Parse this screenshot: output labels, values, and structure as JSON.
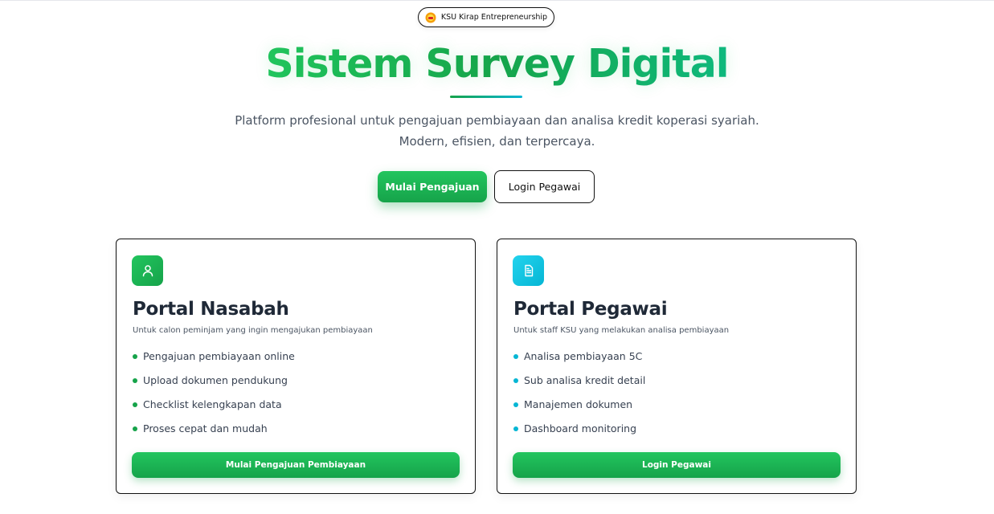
{
  "badge": {
    "label": "KSU Kirap Entrepreneurship",
    "icon": "ksu-logo-icon"
  },
  "hero": {
    "title": "Sistem Survey Digital",
    "subtitle_line1": "Platform profesional untuk pengajuan pembiayaan dan analisa kredit koperasi syariah.",
    "subtitle_line2": "Modern, efisien, dan terpercaya.",
    "primary_button": "Mulai Pengajuan",
    "secondary_button": "Login Pegawai"
  },
  "cards": [
    {
      "icon": "user-icon",
      "title": "Portal Nasabah",
      "description": "Untuk calon peminjam yang ingin mengajukan pembiayaan",
      "features": [
        "Pengajuan pembiayaan online",
        "Upload dokumen pendukung",
        "Checklist kelengkapan data",
        "Proses cepat dan mudah"
      ],
      "button": "Mulai Pengajuan Pembiayaan"
    },
    {
      "icon": "document-icon",
      "title": "Portal Pegawai",
      "description": "Untuk staff KSU yang melakukan analisa pembiayaan",
      "features": [
        "Analisa pembiayaan 5C",
        "Sub analisa kredit detail",
        "Manajemen dokumen",
        "Dashboard monitoring"
      ],
      "button": "Login Pegawai"
    }
  ],
  "colors": {
    "primary_green": "#16a34a",
    "accent_cyan": "#06b6d4",
    "text_dark": "#1f2937"
  }
}
